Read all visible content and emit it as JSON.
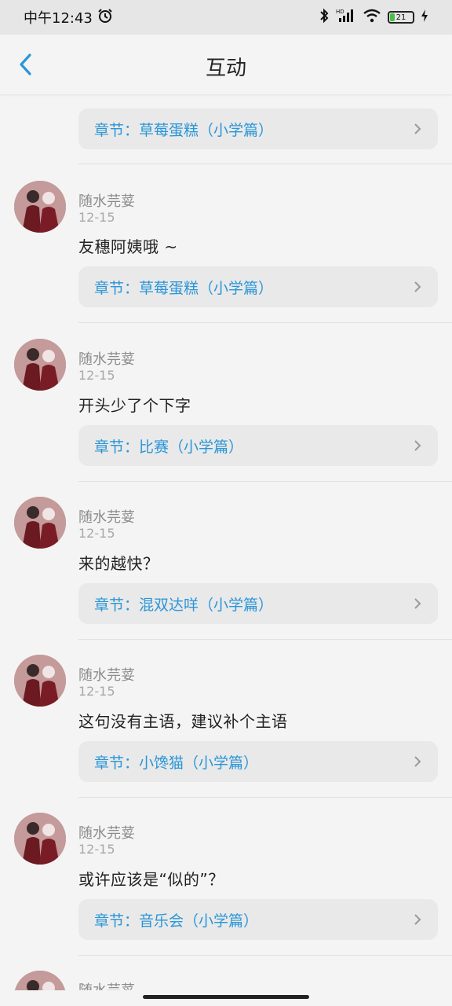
{
  "status": {
    "time": "中午12:43",
    "battery": "21",
    "hd": "HD"
  },
  "header": {
    "title": "互动"
  },
  "top_card": {
    "chapter": "章节：草莓蛋糕（小学篇）"
  },
  "comments": [
    {
      "user": "随水芫荽",
      "date": "12-15",
      "text": "友穗阿姨哦 ~",
      "chapter": "章节：草莓蛋糕（小学篇）"
    },
    {
      "user": "随水芫荽",
      "date": "12-15",
      "text": "开头少了个下字",
      "chapter": "章节：比赛（小学篇）"
    },
    {
      "user": "随水芫荽",
      "date": "12-15",
      "text": "来的越快？",
      "chapter": "章节：混双达咩（小学篇）"
    },
    {
      "user": "随水芫荽",
      "date": "12-15",
      "text": "这句没有主语，建议补个主语",
      "chapter": "章节：小馋猫（小学篇）"
    },
    {
      "user": "随水芫荽",
      "date": "12-15",
      "text": "或许应该是“似的”？",
      "chapter": "章节：音乐会（小学篇）"
    }
  ],
  "partial_next": {
    "user": "随水芫荽"
  },
  "icons": {
    "back": "chevron-left-icon",
    "chevron": "chevron-right-icon",
    "accent": "#2a96d8"
  }
}
